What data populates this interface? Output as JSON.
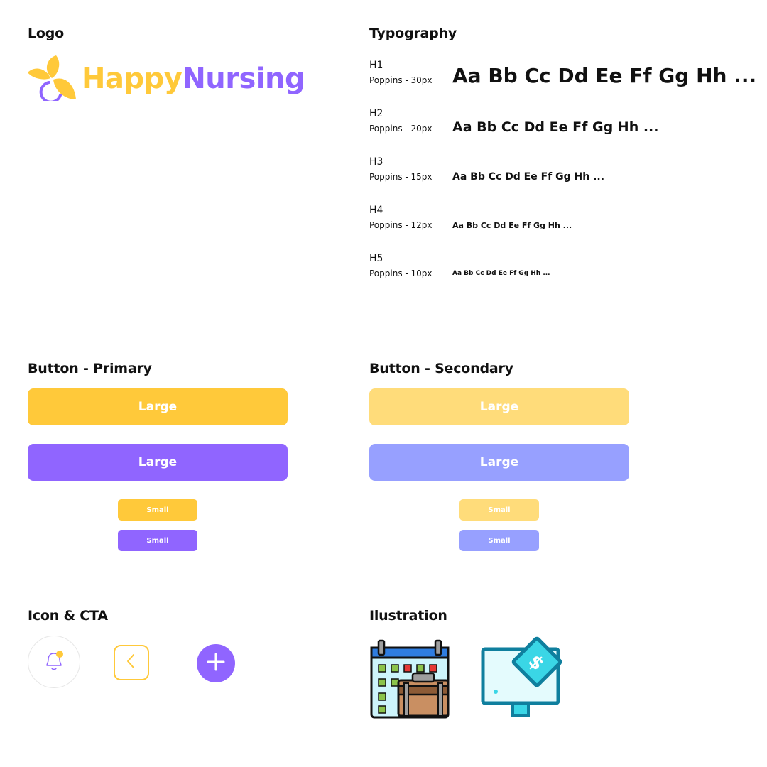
{
  "logo": {
    "section_title": "Logo",
    "word_happy": "Happy",
    "word_nursing": "Nursing",
    "icon": "flower-logo-icon"
  },
  "typography": {
    "section_title": "Typography",
    "rows": [
      {
        "label": "H1",
        "spec": "Poppins - 30px",
        "sample": "Aa Bb Cc Dd Ee Ff Gg Hh ..."
      },
      {
        "label": "H2",
        "spec": "Poppins - 20px",
        "sample": "Aa Bb Cc Dd Ee Ff Gg Hh ..."
      },
      {
        "label": "H3",
        "spec": "Poppins - 15px",
        "sample": "Aa Bb Cc Dd Ee Ff Gg Hh ..."
      },
      {
        "label": "H4",
        "spec": "Poppins - 12px",
        "sample": "Aa Bb Cc Dd Ee Ff Gg Hh ..."
      },
      {
        "label": "H5",
        "spec": "Poppins - 10px",
        "sample": "Aa Bb Cc Dd Ee Ff Gg Hh ..."
      }
    ]
  },
  "button_primary": {
    "section_title": "Button - Primary",
    "large_yellow": "Large",
    "large_purple": "Large",
    "small_yellow": "Small",
    "small_purple": "Small"
  },
  "button_secondary": {
    "section_title": "Button - Secondary",
    "large_yellow": "Large",
    "large_blue": "Large",
    "small_yellow": "Small",
    "small_blue": "Small"
  },
  "icon_cta": {
    "section_title": "Icon & CTA",
    "icons": [
      "bell-notification-icon",
      "chevron-left-icon",
      "plus-icon"
    ]
  },
  "illustration": {
    "section_title": "Ilustration",
    "icons": [
      "calendar-briefcase-icon",
      "monitor-money-icon"
    ]
  },
  "colors": {
    "primary_yellow": "#FFC93A",
    "primary_purple": "#9065FF",
    "secondary_yellow": "#FFDC7A",
    "secondary_blue": "#97A0FF"
  }
}
